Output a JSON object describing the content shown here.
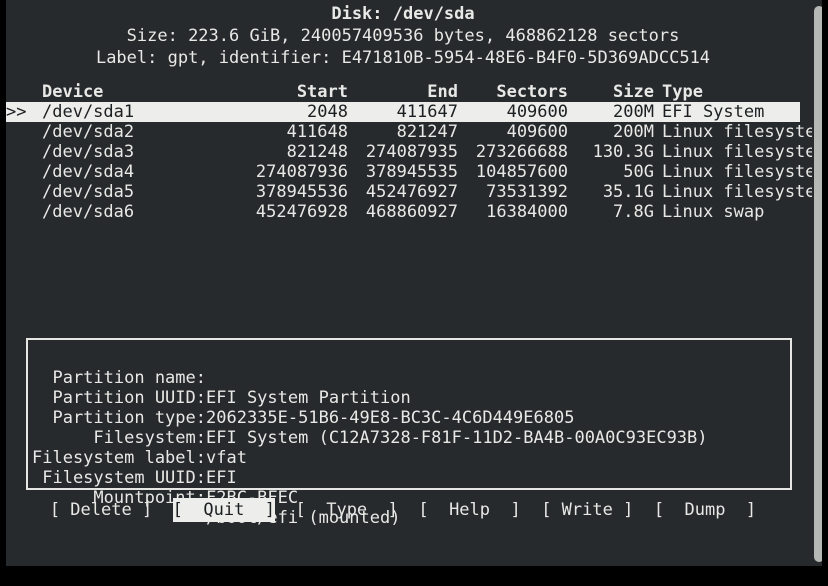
{
  "header": {
    "title": "Disk: /dev/sda",
    "size_line": "Size: 223.6 GiB, 240057409536 bytes, 468862128 sectors",
    "label_line": "Label: gpt, identifier: E471810B-5954-48E6-B4F0-5D369ADCC514"
  },
  "table": {
    "columns": [
      "Device",
      "Start",
      "End",
      "Sectors",
      "Size",
      "Type"
    ],
    "selection_marker": ">>",
    "rows": [
      {
        "marker": ">>",
        "device": "/dev/sda1",
        "start": "2048",
        "end": "411647",
        "sectors": "409600",
        "size": "200M",
        "type": "EFI System",
        "selected": true
      },
      {
        "marker": "",
        "device": "/dev/sda2",
        "start": "411648",
        "end": "821247",
        "sectors": "409600",
        "size": "200M",
        "type": "Linux filesystem",
        "selected": false
      },
      {
        "marker": "",
        "device": "/dev/sda3",
        "start": "821248",
        "end": "274087935",
        "sectors": "273266688",
        "size": "130.3G",
        "type": "Linux filesystem",
        "selected": false
      },
      {
        "marker": "",
        "device": "/dev/sda4",
        "start": "274087936",
        "end": "378945535",
        "sectors": "104857600",
        "size": "50G",
        "type": "Linux filesystem",
        "selected": false
      },
      {
        "marker": "",
        "device": "/dev/sda5",
        "start": "378945536",
        "end": "452476927",
        "sectors": "73531392",
        "size": "35.1G",
        "type": "Linux filesystem",
        "selected": false
      },
      {
        "marker": "",
        "device": "/dev/sda6",
        "start": "452476928",
        "end": "468860927",
        "sectors": "16384000",
        "size": "7.8G",
        "type": "Linux swap",
        "selected": false
      }
    ]
  },
  "details": {
    "rows": [
      {
        "label": "Partition name:",
        "value": "EFI System Partition"
      },
      {
        "label": "Partition UUID:",
        "value": "2062335E-51B6-49E8-BC3C-4C6D449E6805"
      },
      {
        "label": "Partition type:",
        "value": "EFI System (C12A7328-F81F-11D2-BA4B-00A0C93EC93B)"
      },
      {
        "label": "Filesystem:",
        "value": "vfat"
      },
      {
        "label": "Filesystem label:",
        "value": "EFI"
      },
      {
        "label": "Filesystem UUID:",
        "value": "F2BC-BFEC"
      },
      {
        "label": "Mountpoint:",
        "value": "/boot/efi (mounted)"
      }
    ]
  },
  "buttons": [
    {
      "text": "[ Delete ]",
      "name": "delete",
      "active": false
    },
    {
      "text": "[  Quit  ]",
      "name": "quit",
      "active": true
    },
    {
      "text": "[  Type  ]",
      "name": "type",
      "active": false
    },
    {
      "text": "[  Help  ]",
      "name": "help",
      "active": false
    },
    {
      "text": "[ Write ]",
      "name": "write",
      "active": false
    },
    {
      "text": "[  Dump  ]",
      "name": "dump",
      "active": false
    }
  ],
  "colors": {
    "terminal_background": "#262a2c",
    "terminal_foreground": "#e8e8e6",
    "highlight_background": "#ededeb",
    "highlight_foreground": "#1c1f21",
    "panel_border": "#e6e6e4",
    "scrollbar_thumb": "#b4b7b4",
    "frame": "#000000"
  }
}
